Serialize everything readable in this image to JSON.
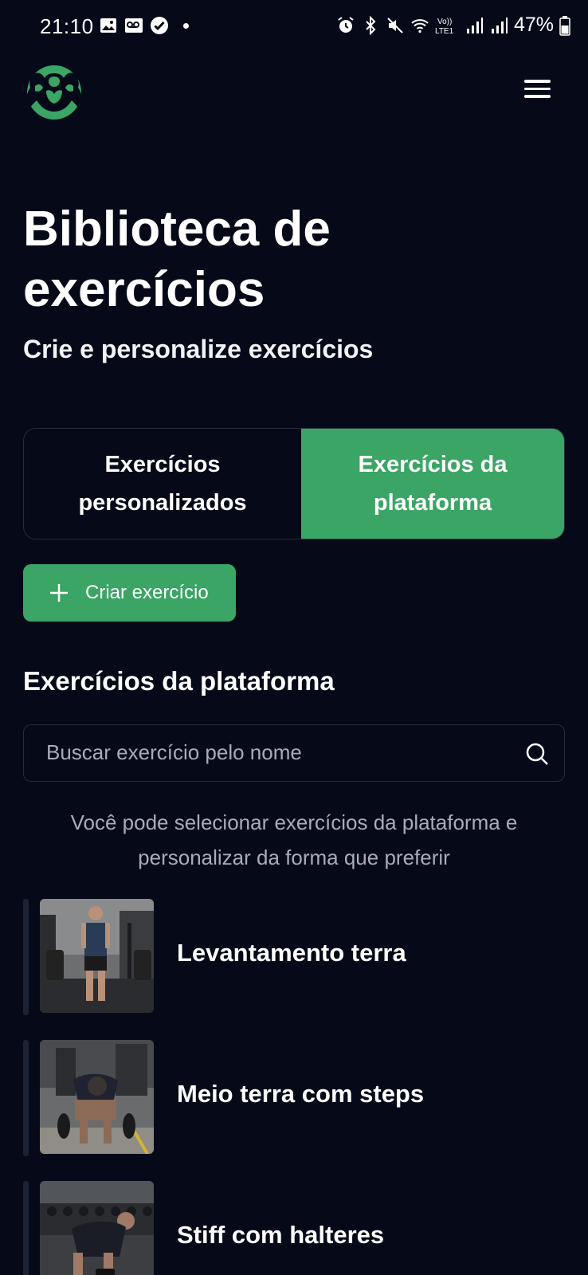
{
  "status_bar": {
    "time": "21:10",
    "battery_percent": "47%",
    "left_icons": [
      "image-icon",
      "voicemail-icon",
      "check-circle-icon"
    ],
    "right_icons": [
      "alarm-icon",
      "bluetooth-icon",
      "mute-icon",
      "wifi-icon",
      "volte-icon",
      "signal-icon",
      "signal-icon",
      "battery-icon"
    ],
    "volte_label": "Vo)) LTE1"
  },
  "header": {
    "logo_icon": "bodybuilder-logo-icon",
    "menu_icon": "hamburger-menu-icon"
  },
  "page": {
    "title": "Biblioteca de exercícios",
    "subtitle": "Crie e personalize exercícios"
  },
  "tabs": [
    {
      "label": "Exercícios personalizados",
      "active": false
    },
    {
      "label": "Exercícios da plataforma",
      "active": true
    }
  ],
  "create_button": {
    "label": "Criar exercício",
    "icon": "plus-icon"
  },
  "section": {
    "title": "Exercícios da plataforma",
    "search_placeholder": "Buscar exercício pelo nome",
    "search_value": "",
    "helper_text": "Você pode selecionar exercícios da plataforma e personalizar da forma que preferir"
  },
  "exercises": [
    {
      "name": "Levantamento terra"
    },
    {
      "name": "Meio terra com steps"
    },
    {
      "name": "Stiff com halteres"
    }
  ],
  "colors": {
    "background": "#060a18",
    "accent_green": "#3aa564",
    "border": "#262c3c",
    "muted_text": "#a6acba"
  }
}
